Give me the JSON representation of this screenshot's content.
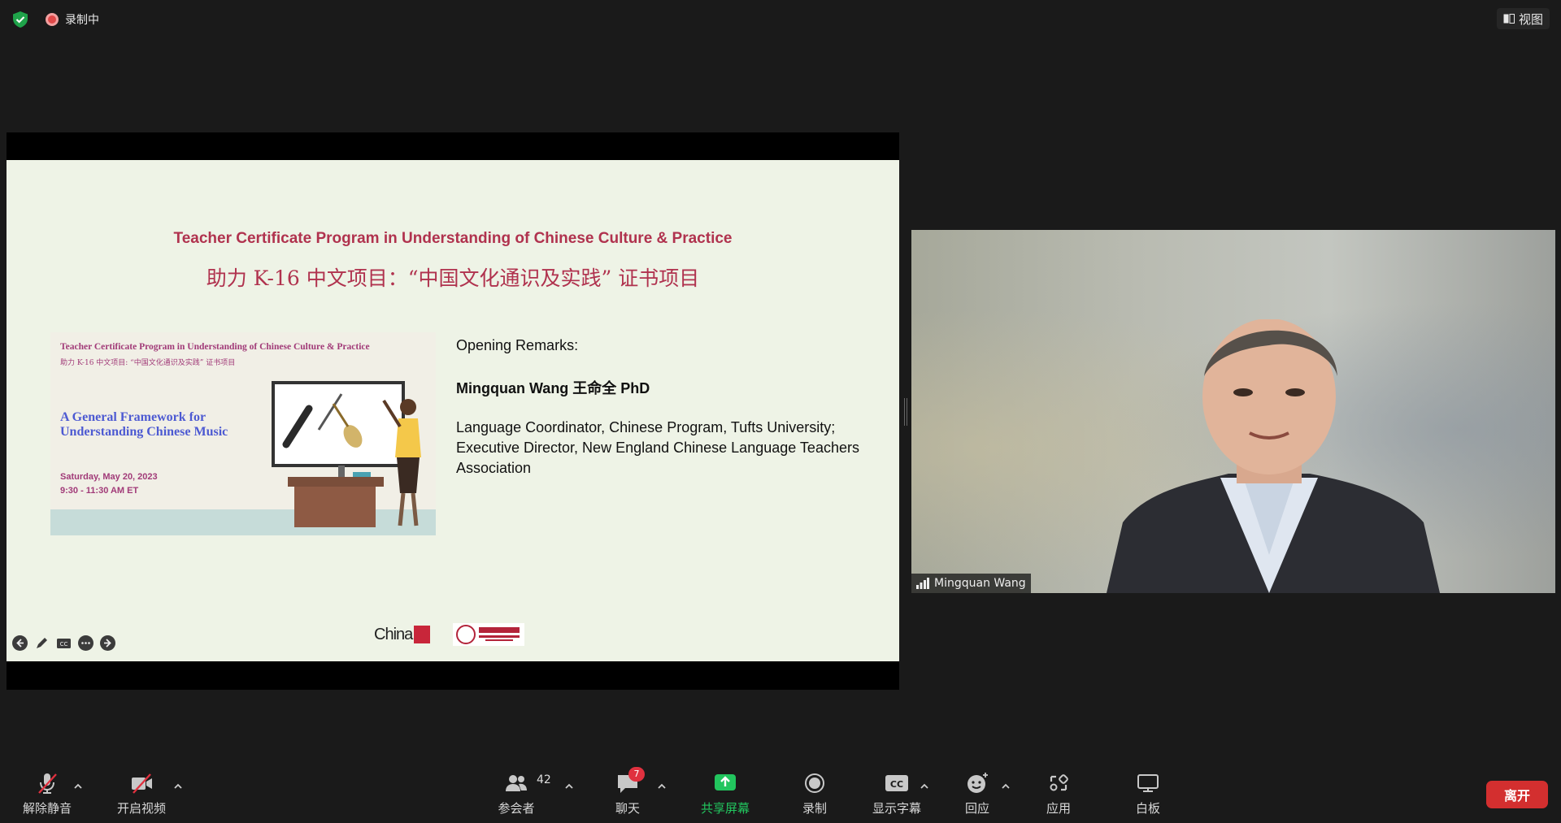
{
  "topbar": {
    "recording_label": "录制中",
    "view_label": "视图"
  },
  "slide": {
    "title_en": "Teacher Certificate Program in Understanding of Chinese Culture & Practice",
    "title_zh": "助力 K-16 中文项目：“中国文化通识及实践” 证书项目",
    "poster": {
      "line1": "Teacher Certificate Program in Understanding of Chinese Culture & Practice",
      "line2": "助力 K-16 中文项目: “中国文化通识及实践” 证书项目",
      "heading": "A General Framework for Understanding Chinese Music",
      "date": "Saturday, May 20, 2023",
      "time": "9:30 - 11:30 AM ET"
    },
    "remarks_heading": "Opening Remarks:",
    "speaker_name": "Mingquan Wang 王命全 PhD",
    "speaker_desc": "Language Coordinator, Chinese Program, Tufts University; Executive Director, New England Chinese Language Teachers Association",
    "logo_china": "China"
  },
  "video": {
    "participant_name": "Mingquan Wang"
  },
  "toolbar": {
    "unmute": "解除静音",
    "start_video": "开启视频",
    "participants": "参会者",
    "participants_count": "42",
    "chat": "聊天",
    "chat_badge": "7",
    "share": "共享屏幕",
    "record": "录制",
    "captions": "显示字幕",
    "reactions": "回应",
    "apps": "应用",
    "whiteboard": "白板",
    "leave": "离开"
  },
  "colors": {
    "accent_green": "#22c55e",
    "leave_red": "#d32f2f",
    "title_red": "#b0324e"
  }
}
